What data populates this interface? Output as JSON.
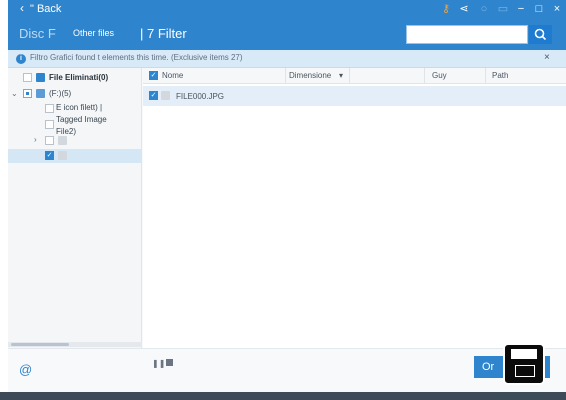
{
  "titlebar": {
    "back_label": "\" Back",
    "icons": [
      "key-icon",
      "share-icon",
      "settings-icon",
      "menu-icon",
      "minimize-icon",
      "maximize-icon",
      "close-icon"
    ],
    "accent": "#2f85cd"
  },
  "toolbar": {
    "disc_label": "Disc F",
    "other_files_label": "Other files",
    "filter_title": "| 7 Filter",
    "search_placeholder": "",
    "search_icon": "search-icon"
  },
  "infobar": {
    "message": "Filtro Grafici found t elements this time. (Exclusive items 27)",
    "close": "×"
  },
  "tree": {
    "root_label": "File Eliminati(0)",
    "drive_label": "(F:)(5)",
    "items": [
      {
        "label": "E icon filett) |"
      },
      {
        "label": "Tagged Image"
      },
      {
        "label": "File2)"
      }
    ]
  },
  "table": {
    "columns": [
      "Nome",
      "Dimensione",
      "Guy",
      "Path"
    ],
    "rows": [
      {
        "name": "FILE000.JPG",
        "size": "",
        "type": "",
        "path": ""
      }
    ]
  },
  "bottom": {
    "recover_label": "Or"
  }
}
